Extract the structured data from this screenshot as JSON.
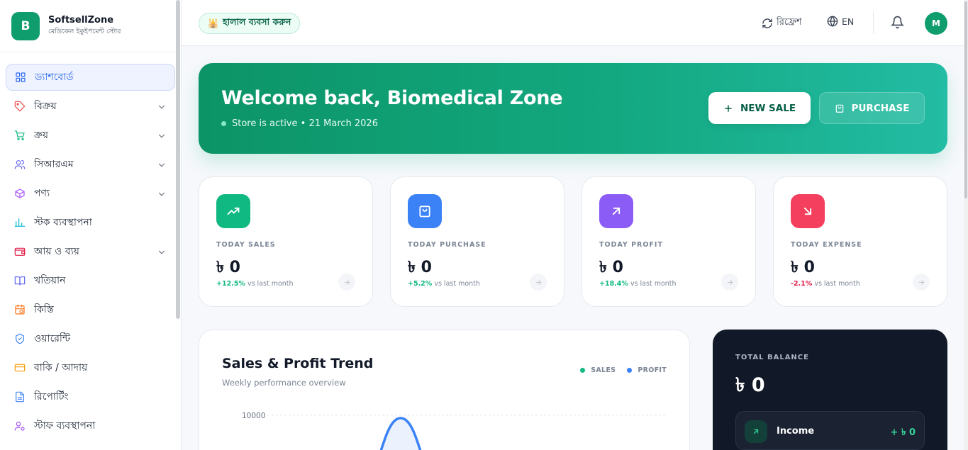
{
  "brand": {
    "logo_letter": "B",
    "name": "SoftsellZone",
    "subtitle": "মেডিকেল ইকুইপমেন্ট স্টোর"
  },
  "sidebar": {
    "items": [
      {
        "label": "ড্যাশবোর্ড",
        "icon": "grid-icon",
        "color": "#2563eb",
        "active": true,
        "has_chevron": false
      },
      {
        "label": "বিক্রয়",
        "icon": "tag-icon",
        "color": "#ef4444",
        "has_chevron": true
      },
      {
        "label": "ক্রয়",
        "icon": "cart-icon",
        "color": "#10b981",
        "has_chevron": true
      },
      {
        "label": "সিআরএম",
        "icon": "users-icon",
        "color": "#6366f1",
        "has_chevron": true
      },
      {
        "label": "পণ্য",
        "icon": "box-icon",
        "color": "#a855f7",
        "has_chevron": true
      },
      {
        "label": "স্টক ব্যবস্থাপনা",
        "icon": "bar-chart-icon",
        "color": "#06b6d4",
        "has_chevron": false
      },
      {
        "label": "আয় ও ব্যয়",
        "icon": "wallet-icon",
        "color": "#e11d48",
        "has_chevron": true
      },
      {
        "label": "খতিয়ান",
        "icon": "book-icon",
        "color": "#6366f1",
        "has_chevron": false
      },
      {
        "label": "কিস্তি",
        "icon": "calendar-clock-icon",
        "color": "#f97316",
        "has_chevron": false
      },
      {
        "label": "ওয়ারেন্টি",
        "icon": "shield-icon",
        "color": "#3b82f6",
        "has_chevron": false
      },
      {
        "label": "বাকি / আদায়",
        "icon": "credit-card-icon",
        "color": "#f59e0b",
        "has_chevron": false
      },
      {
        "label": "রিপোর্টিং",
        "icon": "file-text-icon",
        "color": "#3b82f6",
        "has_chevron": false
      },
      {
        "label": "স্টাফ ব্যবস্থাপনা",
        "icon": "user-cog-icon",
        "color": "#a855f7",
        "has_chevron": false
      }
    ]
  },
  "topbar": {
    "halal_pill": "হালাল ব্যবসা করুন",
    "refresh_label": "রিফ্রেশ",
    "language": "EN",
    "avatar_initial": "M"
  },
  "hero": {
    "title": "Welcome back, Biomedical Zone",
    "status": "Store is active • 21 March 2026",
    "new_sale_label": "NEW SALE",
    "purchase_label": "PURCHASE"
  },
  "stats": [
    {
      "label": "TODAY SALES",
      "value": "৳ 0",
      "change": "+12.5%",
      "change_suffix": " vs last month",
      "icon": "trending-up-icon",
      "color": "#10b981",
      "change_color": "#10b981"
    },
    {
      "label": "TODAY PURCHASE",
      "value": "৳ 0",
      "change": "+5.2%",
      "change_suffix": " vs last month",
      "icon": "shopping-bag-icon",
      "color": "#3b82f6",
      "change_color": "#10b981"
    },
    {
      "label": "TODAY PROFIT",
      "value": "৳ 0",
      "change": "+18.4%",
      "change_suffix": " vs last month",
      "icon": "arrow-up-right-icon",
      "color": "#8b5cf6",
      "change_color": "#10b981"
    },
    {
      "label": "TODAY EXPENSE",
      "value": "৳ 0",
      "change": "-2.1%",
      "change_suffix": " vs last month",
      "icon": "arrow-down-right-icon",
      "color": "#f43f5e",
      "change_color": "#e11d48"
    }
  ],
  "chart_panel": {
    "title": "Sales & Profit Trend",
    "subtitle": "Weekly performance overview",
    "legend": [
      {
        "name": "SALES",
        "color": "#10b981"
      },
      {
        "name": "PROFIT",
        "color": "#3b82f6"
      }
    ]
  },
  "chart_data": {
    "type": "area",
    "title": "Sales & Profit Trend",
    "subtitle": "Weekly performance overview",
    "y_ticks_visible": [
      "10000"
    ],
    "series": [
      {
        "name": "SALES",
        "color": "#10b981"
      },
      {
        "name": "PROFIT",
        "color": "#3b82f6"
      }
    ],
    "legend_position": "top-right",
    "grid": true
  },
  "balance": {
    "label": "TOTAL BALANCE",
    "value": "৳ 0",
    "income_label": "Income",
    "income_value": "+ ৳ 0"
  }
}
